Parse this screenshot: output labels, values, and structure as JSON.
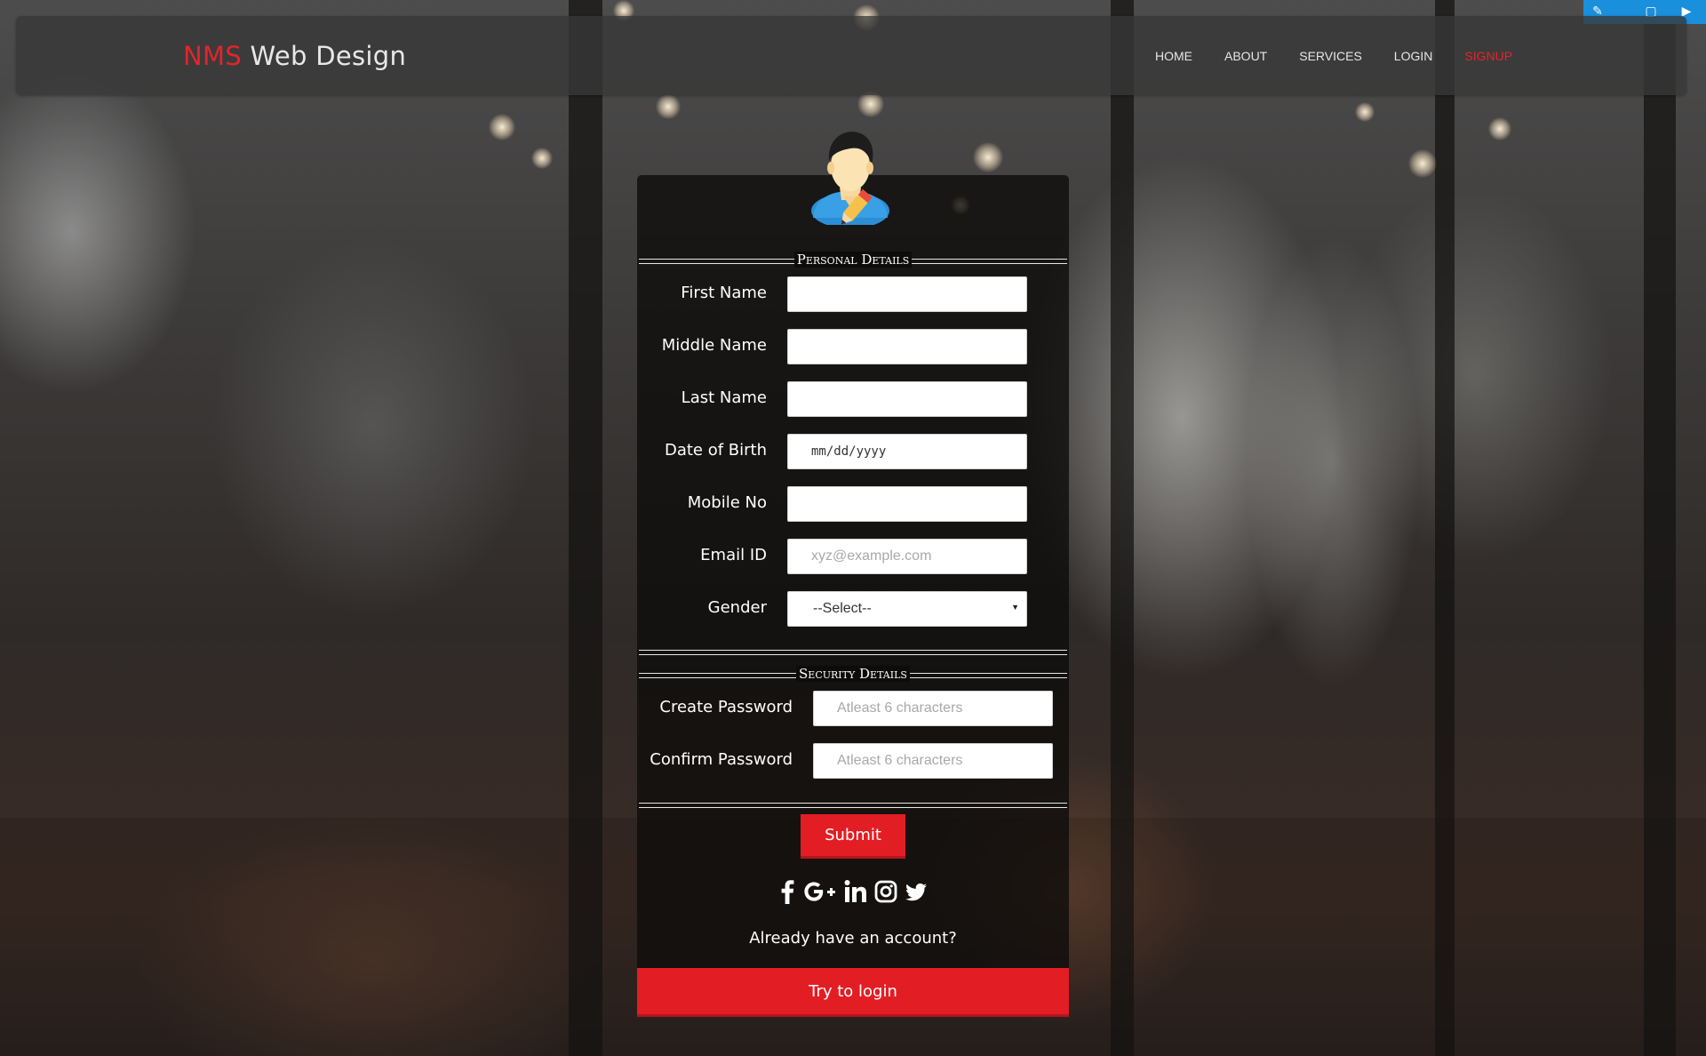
{
  "brand": {
    "accent": "NMS",
    "rest": " Web Design"
  },
  "nav": {
    "home": "HOME",
    "about": "ABOUT",
    "services": "SERVICES",
    "login": "LOGIN",
    "signup": "SIGNUP"
  },
  "colors": {
    "accent": "#e31d24",
    "navbar": "#373737",
    "card": "#0e0c0b"
  },
  "form": {
    "personal_title": "Personal Details",
    "security_title": "Security Details",
    "fields": {
      "first_name": {
        "label": "First Name",
        "value": ""
      },
      "middle_name": {
        "label": "Middle Name",
        "value": ""
      },
      "last_name": {
        "label": "Last Name",
        "value": ""
      },
      "dob": {
        "label": "Date of Birth",
        "placeholder": "mm/dd/yyyy"
      },
      "mobile": {
        "label": "Mobile No",
        "value": ""
      },
      "email": {
        "label": "Email ID",
        "placeholder": "xyz@example.com"
      },
      "gender": {
        "label": "Gender",
        "selected": "--Select--"
      },
      "create_password": {
        "label": "Create Password",
        "placeholder": "Atleast 6 characters"
      },
      "confirm_password": {
        "label": "Confirm Password",
        "placeholder": "Atleast 6 characters"
      }
    },
    "submit_label": "Submit",
    "social_icons": [
      "facebook-icon",
      "google-plus-icon",
      "linkedin-icon",
      "instagram-icon",
      "twitter-icon"
    ],
    "already_text": "Already have an account?",
    "login_label": "Try to login"
  }
}
